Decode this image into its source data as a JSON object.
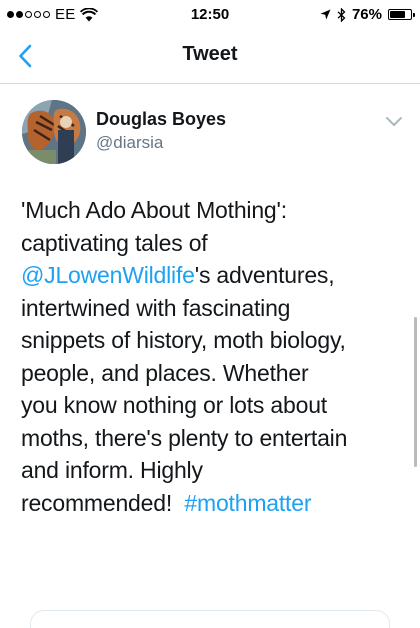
{
  "status_bar": {
    "carrier": "EE",
    "time": "12:50",
    "battery_percent": "76%",
    "battery_level": 0.76,
    "signal_bars_filled": 2,
    "signal_bars_total": 5
  },
  "nav": {
    "title": "Tweet",
    "back_icon": "chevron-left-icon"
  },
  "tweet": {
    "author_name": "Douglas Boyes",
    "author_handle": "@diarsia",
    "text_segments": [
      {
        "text": "'Much Ado About Mothing':",
        "link": false
      },
      {
        "text": "captivating tales of",
        "link": false
      },
      {
        "text": "@JLowenWildlife",
        "link": true
      },
      {
        "text": "'s adventures,",
        "link": false
      },
      {
        "text": "intertwined with fascinating",
        "link": false
      },
      {
        "text": "snippets of history, moth biology,",
        "link": false
      },
      {
        "text": "people, and places. Whether",
        "link": false
      },
      {
        "text": "you know nothing or lots about",
        "link": false
      },
      {
        "text": "moths, there's plenty to entertain",
        "link": false
      },
      {
        "text": "and inform. Highly",
        "link": false
      },
      {
        "text": "recommended!  ",
        "link": false
      },
      {
        "text": "#mothmatter",
        "link": true
      }
    ]
  },
  "colors": {
    "link": "#1da1f2",
    "text": "#14171a",
    "secondary_text": "#657786"
  }
}
